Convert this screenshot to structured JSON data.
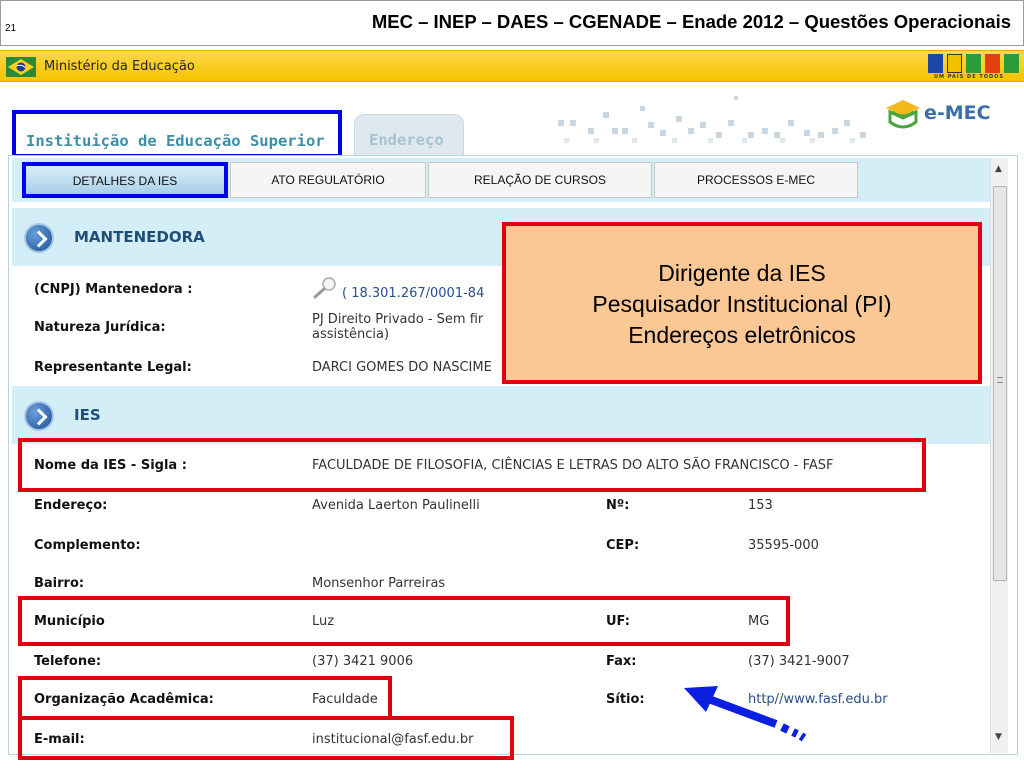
{
  "slide": {
    "number": "21",
    "title": "MEC – INEP – DAES – CGENADE – Enade 2012 – Questões Operacionais"
  },
  "gov_bar": {
    "ministry": "Ministério da Educação",
    "brand": "BRASIL",
    "motto": "UM PAÍS DE TODOS"
  },
  "logo": {
    "text": "e-MEC"
  },
  "main_tabs": [
    {
      "label": "Instituição de Educação Superior",
      "active": true
    },
    {
      "label": "Endereço",
      "active": false
    }
  ],
  "sub_tabs": [
    {
      "label": "DETALHES DA IES",
      "active": true
    },
    {
      "label": "ATO REGULATÓRIO",
      "active": false
    },
    {
      "label": "RELAÇÃO DE CURSOS",
      "active": false
    },
    {
      "label": "PROCESSOS E-MEC",
      "active": false
    }
  ],
  "mantenedora": {
    "section_title": "MANTENEDORA",
    "rows": [
      {
        "label": "(CNPJ) Mantenedora :",
        "value": "( 18.301.267/0001-84"
      },
      {
        "label": "Natureza Jurídica:",
        "value": "PJ Direito Privado - Sem fir\nassistência)"
      },
      {
        "label": "Representante Legal:",
        "value": "DARCI GOMES DO NASCIME"
      }
    ]
  },
  "ies": {
    "section_title": "IES",
    "name_label": "Nome da IES - Sigla :",
    "name_value": "FACULDADE DE FILOSOFIA, CIÊNCIAS E LETRAS DO ALTO SÃO FRANCISCO - FASF",
    "rows": [
      {
        "label": "Endereço:",
        "value": "Avenida Laerton Paulinelli",
        "label2": "Nº:",
        "value2": "153"
      },
      {
        "label": "Complemento:",
        "value": "",
        "label2": "CEP:",
        "value2": "35595-000"
      },
      {
        "label": "Bairro:",
        "value": "Monsenhor Parreiras",
        "label2": "",
        "value2": ""
      },
      {
        "label": "Município",
        "value": "Luz",
        "label2": "UF:",
        "value2": "MG"
      },
      {
        "label": "Telefone:",
        "value": "(37) 3421 9006",
        "label2": "Fax:",
        "value2": "(37) 3421-9007"
      },
      {
        "label": "Organização Acadêmica:",
        "value": "Faculdade",
        "label2": "Sítio:",
        "value2": "http//www.fasf.edu.br"
      },
      {
        "label": "E-mail:",
        "value": "institucional@fasf.edu.br",
        "label2": "",
        "value2": ""
      }
    ]
  },
  "callout": {
    "lines": [
      "Dirigente da IES",
      "Pesquisador Institucional (PI)",
      "Endereços eletrônicos"
    ]
  },
  "colors": {
    "highlight_red": "#e00010",
    "highlight_blue": "#0000ee",
    "section_bg": "#d3eef6",
    "callout_bg": "#fbc895",
    "gov_yellow": "#f5c400"
  },
  "icons": {
    "flag": "brazil-flag-icon",
    "search": "magnifier-icon",
    "section": "chevron-circle-icon",
    "logo": "emec-hat-icon",
    "arrow": "blue-arrow-icon"
  }
}
